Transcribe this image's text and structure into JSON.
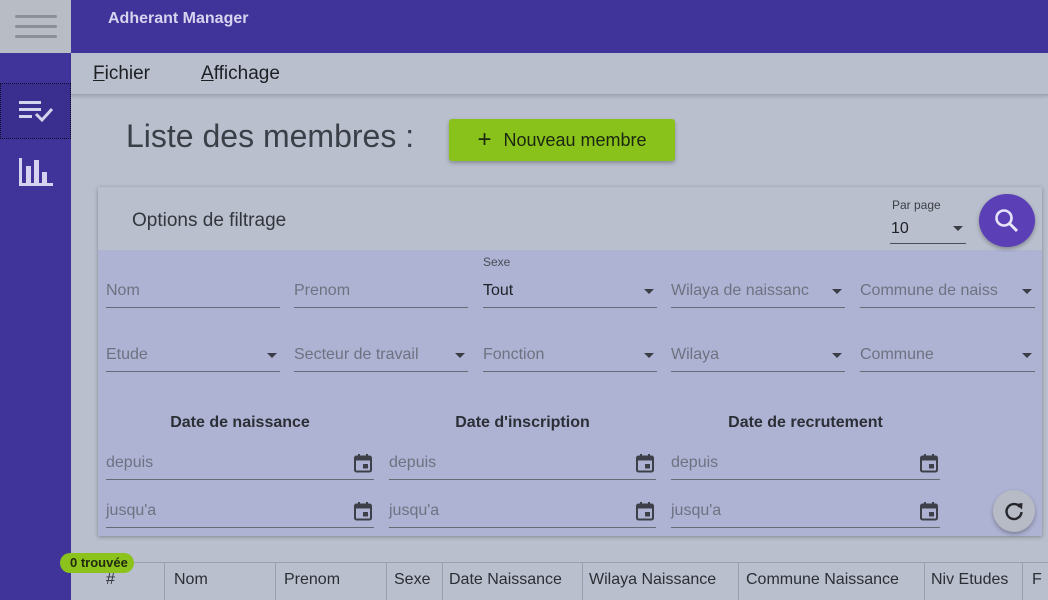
{
  "app": {
    "title": "Adherant Manager"
  },
  "rail": {
    "items": [
      {
        "icon": "playlist-check-icon"
      },
      {
        "icon": "bar-chart-icon"
      }
    ]
  },
  "menu": {
    "fichier": {
      "first": "F",
      "rest": "ichier"
    },
    "affichage": {
      "first": "A",
      "rest": "ffichage"
    }
  },
  "page": {
    "title": "Liste des membres :",
    "new_button": "Nouveau membre"
  },
  "filter": {
    "title": "Options de filtrage",
    "per_page_label": "Par page",
    "per_page_value": "10",
    "nom": "Nom",
    "prenom": "Prenom",
    "sexe_label": "Sexe",
    "sexe_value": "Tout",
    "wilaya_naissance": "Wilaya de naissanc",
    "commune_naissance": "Commune de naiss",
    "etude": "Etude",
    "secteur": "Secteur de travail",
    "fonction": "Fonction",
    "wilaya": "Wilaya",
    "commune": "Commune",
    "date_naissance": "Date de naissance",
    "date_inscription": "Date d'inscription",
    "date_recrutement": "Date de recrutement",
    "depuis": "depuis",
    "jusqua": "jusqu'a"
  },
  "results": {
    "badge": "0 trouvée"
  },
  "table": {
    "columns": [
      "#",
      "Nom",
      "Prenom",
      "Sexe",
      "Date Naissance",
      "Wilaya Naissance",
      "Commune Naissance",
      "Niv Etudes",
      "F"
    ]
  }
}
